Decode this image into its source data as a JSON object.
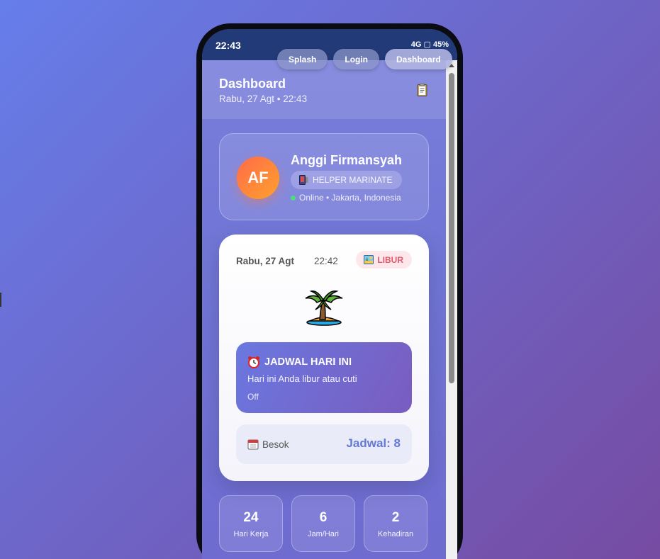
{
  "status_bar": {
    "time": "22:43",
    "indicators": "4G ▢ 45%"
  },
  "nav": {
    "splash": "Splash",
    "login": "Login",
    "dashboard": "Dashboard"
  },
  "header": {
    "title": "Dashboard",
    "subtitle": "Rabu, 27 Agt • 22:43",
    "icon": "clipboard-icon"
  },
  "profile": {
    "initials": "AF",
    "name": "Anggi Firmansyah",
    "role": "HELPER MARINATE",
    "status": "Online • Jakarta, Indonesia",
    "status_color": "#4ade80"
  },
  "today": {
    "date": "Rabu, 27 Agt",
    "time": "22:42",
    "badge": "LIBUR",
    "badge_color": "#e05a6c",
    "illustration": "palm-tree-icon"
  },
  "schedule": {
    "title": "JADWAL HARI INI",
    "description": "Hari ini Anda libur atau cuti",
    "shift": "Off",
    "icon": "alarm-clock-icon"
  },
  "tomorrow": {
    "label": "Besok",
    "value": "Jadwal: 8",
    "icon": "calendar-icon"
  },
  "stats": [
    {
      "value": "24",
      "label": "Hari Kerja"
    },
    {
      "value": "6",
      "label": "Jam/Hari"
    },
    {
      "value": "2",
      "label": "Kehadiran"
    }
  ],
  "colors": {
    "background_start": "#667eea",
    "background_end": "#764ba2",
    "accent": "#6478d6"
  }
}
